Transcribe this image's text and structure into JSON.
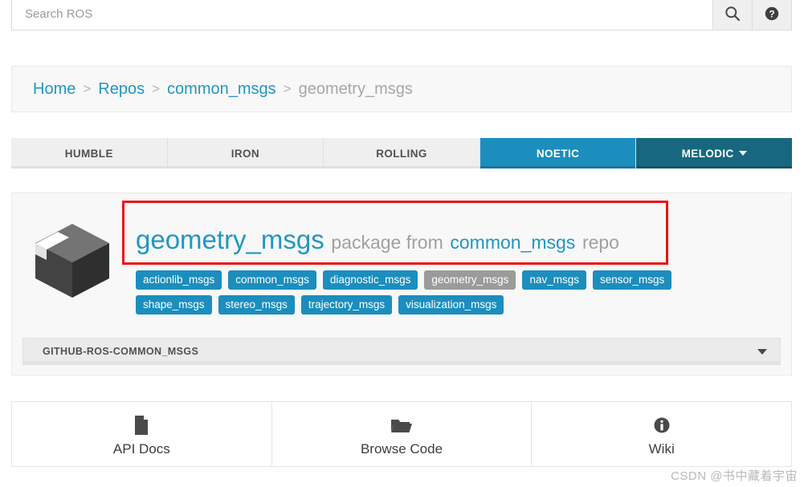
{
  "search": {
    "placeholder": "Search ROS",
    "value": "",
    "search_icon": "search-icon",
    "help_icon": "help-circle-icon"
  },
  "breadcrumb": {
    "items": [
      {
        "label": "Home",
        "current": false
      },
      {
        "label": "Repos",
        "current": false
      },
      {
        "label": "common_msgs",
        "current": false
      },
      {
        "label": "geometry_msgs",
        "current": true
      }
    ],
    "separator": ">"
  },
  "tabs": [
    {
      "label": "HUMBLE",
      "state": "inactive"
    },
    {
      "label": "IRON",
      "state": "inactive"
    },
    {
      "label": "ROLLING",
      "state": "inactive"
    },
    {
      "label": "NOETIC",
      "state": "active"
    },
    {
      "label": "MELODIC",
      "state": "dropdown"
    }
  ],
  "package": {
    "icon": "package-box-icon",
    "name": "geometry_msgs",
    "middle_text": "package from",
    "repo": "common_msgs",
    "suffix_text": "repo",
    "badges": [
      {
        "label": "actionlib_msgs",
        "active": false
      },
      {
        "label": "common_msgs",
        "active": false
      },
      {
        "label": "diagnostic_msgs",
        "active": false
      },
      {
        "label": "geometry_msgs",
        "active": true
      },
      {
        "label": "nav_msgs",
        "active": false
      },
      {
        "label": "sensor_msgs",
        "active": false
      },
      {
        "label": "shape_msgs",
        "active": false
      },
      {
        "label": "stereo_msgs",
        "active": false
      },
      {
        "label": "trajectory_msgs",
        "active": false
      },
      {
        "label": "visualization_msgs",
        "active": false
      }
    ]
  },
  "accordion": {
    "title": "GITHUB-ROS-COMMON_MSGS",
    "caret_icon": "chevron-down-icon"
  },
  "actions": [
    {
      "label": "API Docs",
      "icon": "file-doc-icon"
    },
    {
      "label": "Browse Code",
      "icon": "folder-open-icon"
    },
    {
      "label": "Wiki",
      "icon": "info-circle-icon"
    }
  ],
  "watermark": "CSDN @书中藏着宇宙",
  "colors": {
    "accent_blue": "#1b8ebe",
    "link_blue": "#2196c4",
    "dark_teal": "#17687f",
    "muted_gray": "#9b9b9b",
    "annotation_red": "#ee1111"
  }
}
